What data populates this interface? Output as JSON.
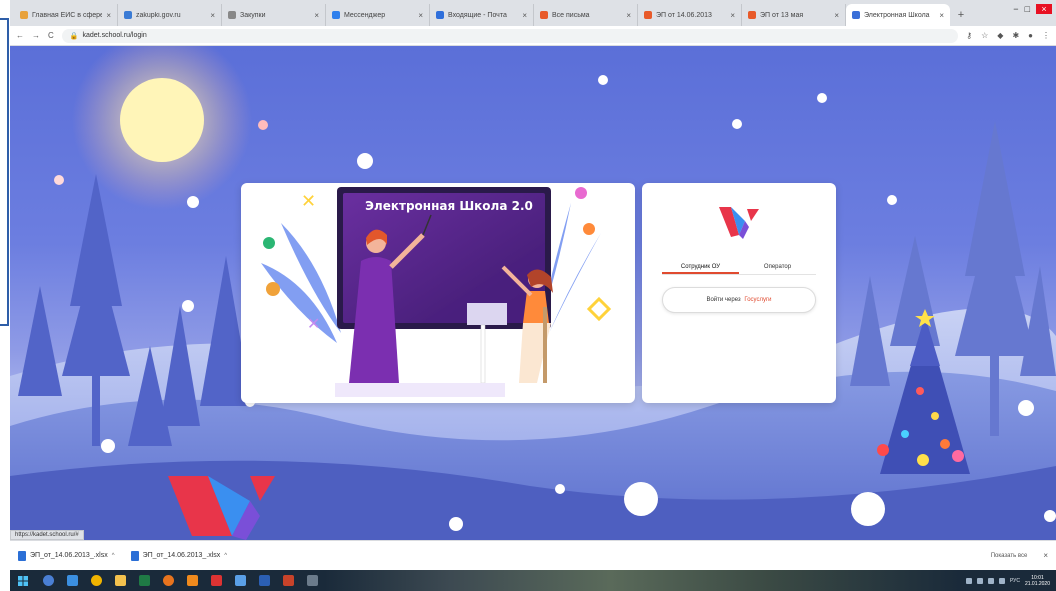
{
  "browser": {
    "tabs": [
      {
        "label": "Главная ЕИС в сфере",
        "color": "#e8a23c"
      },
      {
        "label": "zakupki.gov.ru",
        "color": "#3a7bd5"
      },
      {
        "label": "Закупки",
        "color": "#888888"
      },
      {
        "label": "Мессенджер",
        "color": "#2f80ed"
      },
      {
        "label": "Входящие - Почта",
        "color": "#2f6fdb"
      },
      {
        "label": "Все письма",
        "color": "#e85a2a"
      },
      {
        "label": "ЭП от 14.06.2013",
        "color": "#e85a2a"
      },
      {
        "label": "ЭП от 13 мая",
        "color": "#e85a2a"
      },
      {
        "label": "Электронная Школа",
        "color": "#3a6fd8",
        "active": true
      }
    ],
    "new_tab_glyph": "+",
    "window_controls": [
      "−",
      "□",
      "×"
    ],
    "address": "kadet.school.ru/login",
    "nav_glyphs": {
      "back": "←",
      "forward": "→",
      "reload": "C"
    }
  },
  "page": {
    "board_title": "Электронная Школа 2.0",
    "login_tabs": [
      {
        "label": "Сотрудник ОУ",
        "selected": true
      },
      {
        "label": "Оператор",
        "selected": false
      }
    ],
    "login_button": {
      "prefix": "Войти через",
      "service": "Госуслуги"
    },
    "colors": {
      "accent_red": "#e04a2f",
      "sky": "#5b6fd8",
      "board": "#5a2a8a"
    }
  },
  "status_url": "https://kadet.school.ru/#",
  "downloads": {
    "items": [
      {
        "name": "ЭП_от_14.06.2013_.xlsx",
        "chevron": "^"
      },
      {
        "name": "ЭП_от_14.06.2013_.xlsx",
        "chevron": "^"
      }
    ],
    "show_all": "Показать все",
    "close_glyph": "×"
  },
  "taskbar": {
    "apps": [
      {
        "icon": "cortana-icon",
        "color": "#4a7fd4"
      },
      {
        "icon": "ie-icon",
        "color": "#3b8fe0"
      },
      {
        "icon": "chrome-icon",
        "color": "#f0b400"
      },
      {
        "icon": "explorer-icon",
        "color": "#f2c14e"
      },
      {
        "icon": "excel-icon",
        "color": "#1f7a45"
      },
      {
        "icon": "firefox-icon",
        "color": "#e8741e"
      },
      {
        "icon": "odnoklassniki-icon",
        "color": "#f08a1d"
      },
      {
        "icon": "yandex-icon",
        "color": "#d33"
      },
      {
        "icon": "mail-icon",
        "color": "#5aa0e8"
      },
      {
        "icon": "word-icon",
        "color": "#2b5fb4"
      },
      {
        "icon": "powerpoint-icon",
        "color": "#c8432a"
      },
      {
        "icon": "settings-icon",
        "color": "#6b7b8b"
      }
    ],
    "clock": {
      "time": "10:01",
      "date": "21.01.2020"
    },
    "language": "РУС"
  }
}
